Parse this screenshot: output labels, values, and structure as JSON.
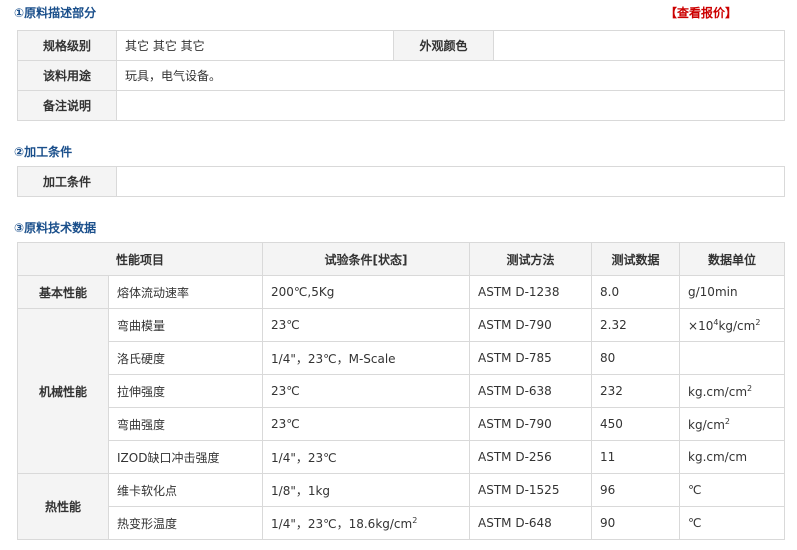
{
  "section1": {
    "title": "①原料描述部分",
    "quote_link": "【查看报价】",
    "rows": {
      "spec_label": "规格级别",
      "spec_value": "其它 其它 其它",
      "color_label": "外观颜色",
      "color_value": "",
      "use_label": "该料用途",
      "use_value": "玩具，电气设备。",
      "note_label": "备注说明",
      "note_value": ""
    }
  },
  "section2": {
    "title": "②加工条件",
    "label": "加工条件",
    "value": ""
  },
  "section3": {
    "title": "③原料技术数据",
    "headers": [
      "性能项目",
      "试验条件[状态]",
      "测试方法",
      "测试数据",
      "数据单位"
    ],
    "rows": [
      {
        "category": "基本性能",
        "item": "熔体流动速率",
        "condition": "200℃,5Kg",
        "method": "ASTM D-1238",
        "value": "8.0",
        "unit": "g/10min"
      },
      {
        "category": "机械性能",
        "item": "弯曲模量",
        "condition": "23℃",
        "method": "ASTM D-790",
        "value": "2.32",
        "unit": "×10",
        "unit_sup": "4",
        "unit_post": "kg/cm",
        "unit_sup2": "2"
      },
      {
        "item": "洛氏硬度",
        "condition": "1/4\"，23℃，M-Scale",
        "method": "ASTM D-785",
        "value": "80",
        "unit": ""
      },
      {
        "item": "拉伸强度",
        "condition": "23℃",
        "method": "ASTM D-638",
        "value": "232",
        "unit": "kg.cm/cm",
        "unit_sup": "2"
      },
      {
        "item": "弯曲强度",
        "condition": "23℃",
        "method": "ASTM D-790",
        "value": "450",
        "unit": "kg/cm",
        "unit_sup": "2"
      },
      {
        "item": "IZOD缺口冲击强度",
        "condition": "1/4\"，23℃",
        "method": "ASTM D-256",
        "value": "11",
        "unit": "kg.cm/cm"
      },
      {
        "category": "热性能",
        "item": "维卡软化点",
        "condition": "1/8\"，1kg",
        "method": "ASTM D-1525",
        "value": "96",
        "unit": "℃"
      },
      {
        "item": "热变形温度",
        "condition": "1/4\"，23℃，18.6kg/cm",
        "condition_sup": "2",
        "method": "ASTM D-648",
        "value": "90",
        "unit": "℃"
      }
    ]
  }
}
